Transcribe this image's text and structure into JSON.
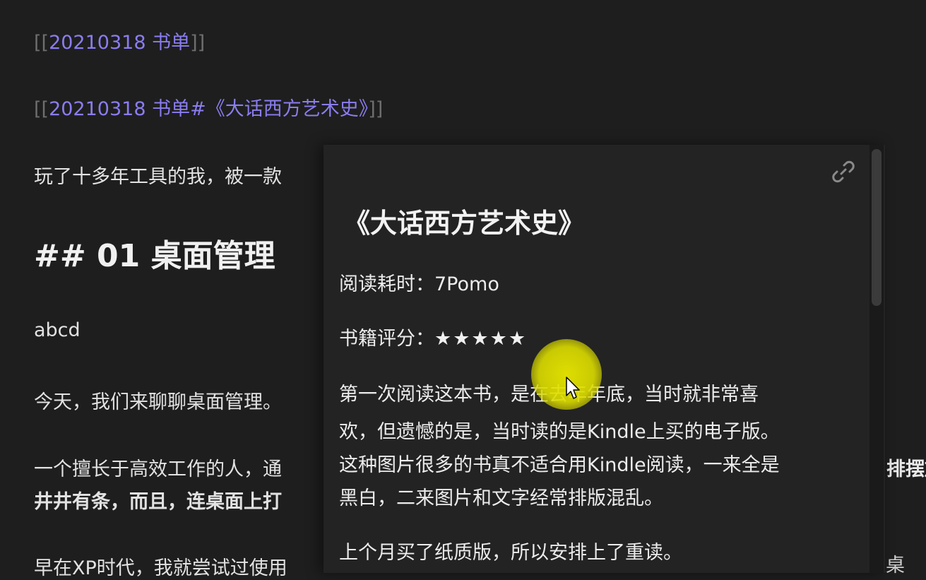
{
  "editor": {
    "wikilink1": {
      "open": "[[",
      "target": "20210318 书单",
      "close": "]]"
    },
    "wikilink2": {
      "open": "[[",
      "target": "20210318 书单#《大话西方艺术史》",
      "close": "]]"
    },
    "intro_text": "玩了十多年工具的我，被一款",
    "heading": "## 01 桌面管理",
    "abcd": "abcd",
    "today_text": "今天，我们来聊聊桌面管理。",
    "efficient_text": "一个擅长于高效工作的人，通",
    "orderly_text": "井井有条，而且，连桌面上打",
    "xp_text": "早在XP时代，我就尝试过使用",
    "right_overflow_text": "排摆放",
    "bottom_overflow_text": "虚拟桌"
  },
  "popover": {
    "title": "《大话西方艺术史》",
    "reading_time_label": "阅读耗时：",
    "reading_time_value": "7Pomo",
    "rating_label": "书籍评分：",
    "rating_stars": "★★★★★",
    "rating_value": 5,
    "rating_max": 5,
    "paragraph1_lines": [
      "第一次阅读这本书，是在去年年底，当时就非常喜",
      "欢，但遗憾的是，当时读的是Kindle上买的电子版。",
      "这种图片很多的书真不适合用Kindle阅读，一来全是",
      "黑白，二来图片和文字经常排版混乱。"
    ],
    "paragraph2": "上个月买了纸质版，所以安排上了重读。",
    "link_icon": "link-icon"
  },
  "colors": {
    "background": "#1e1e1e",
    "link": "#8a7df0",
    "bracket": "#6e6e6e",
    "text": "#e2e2e2",
    "highlight": "#e8e800"
  }
}
